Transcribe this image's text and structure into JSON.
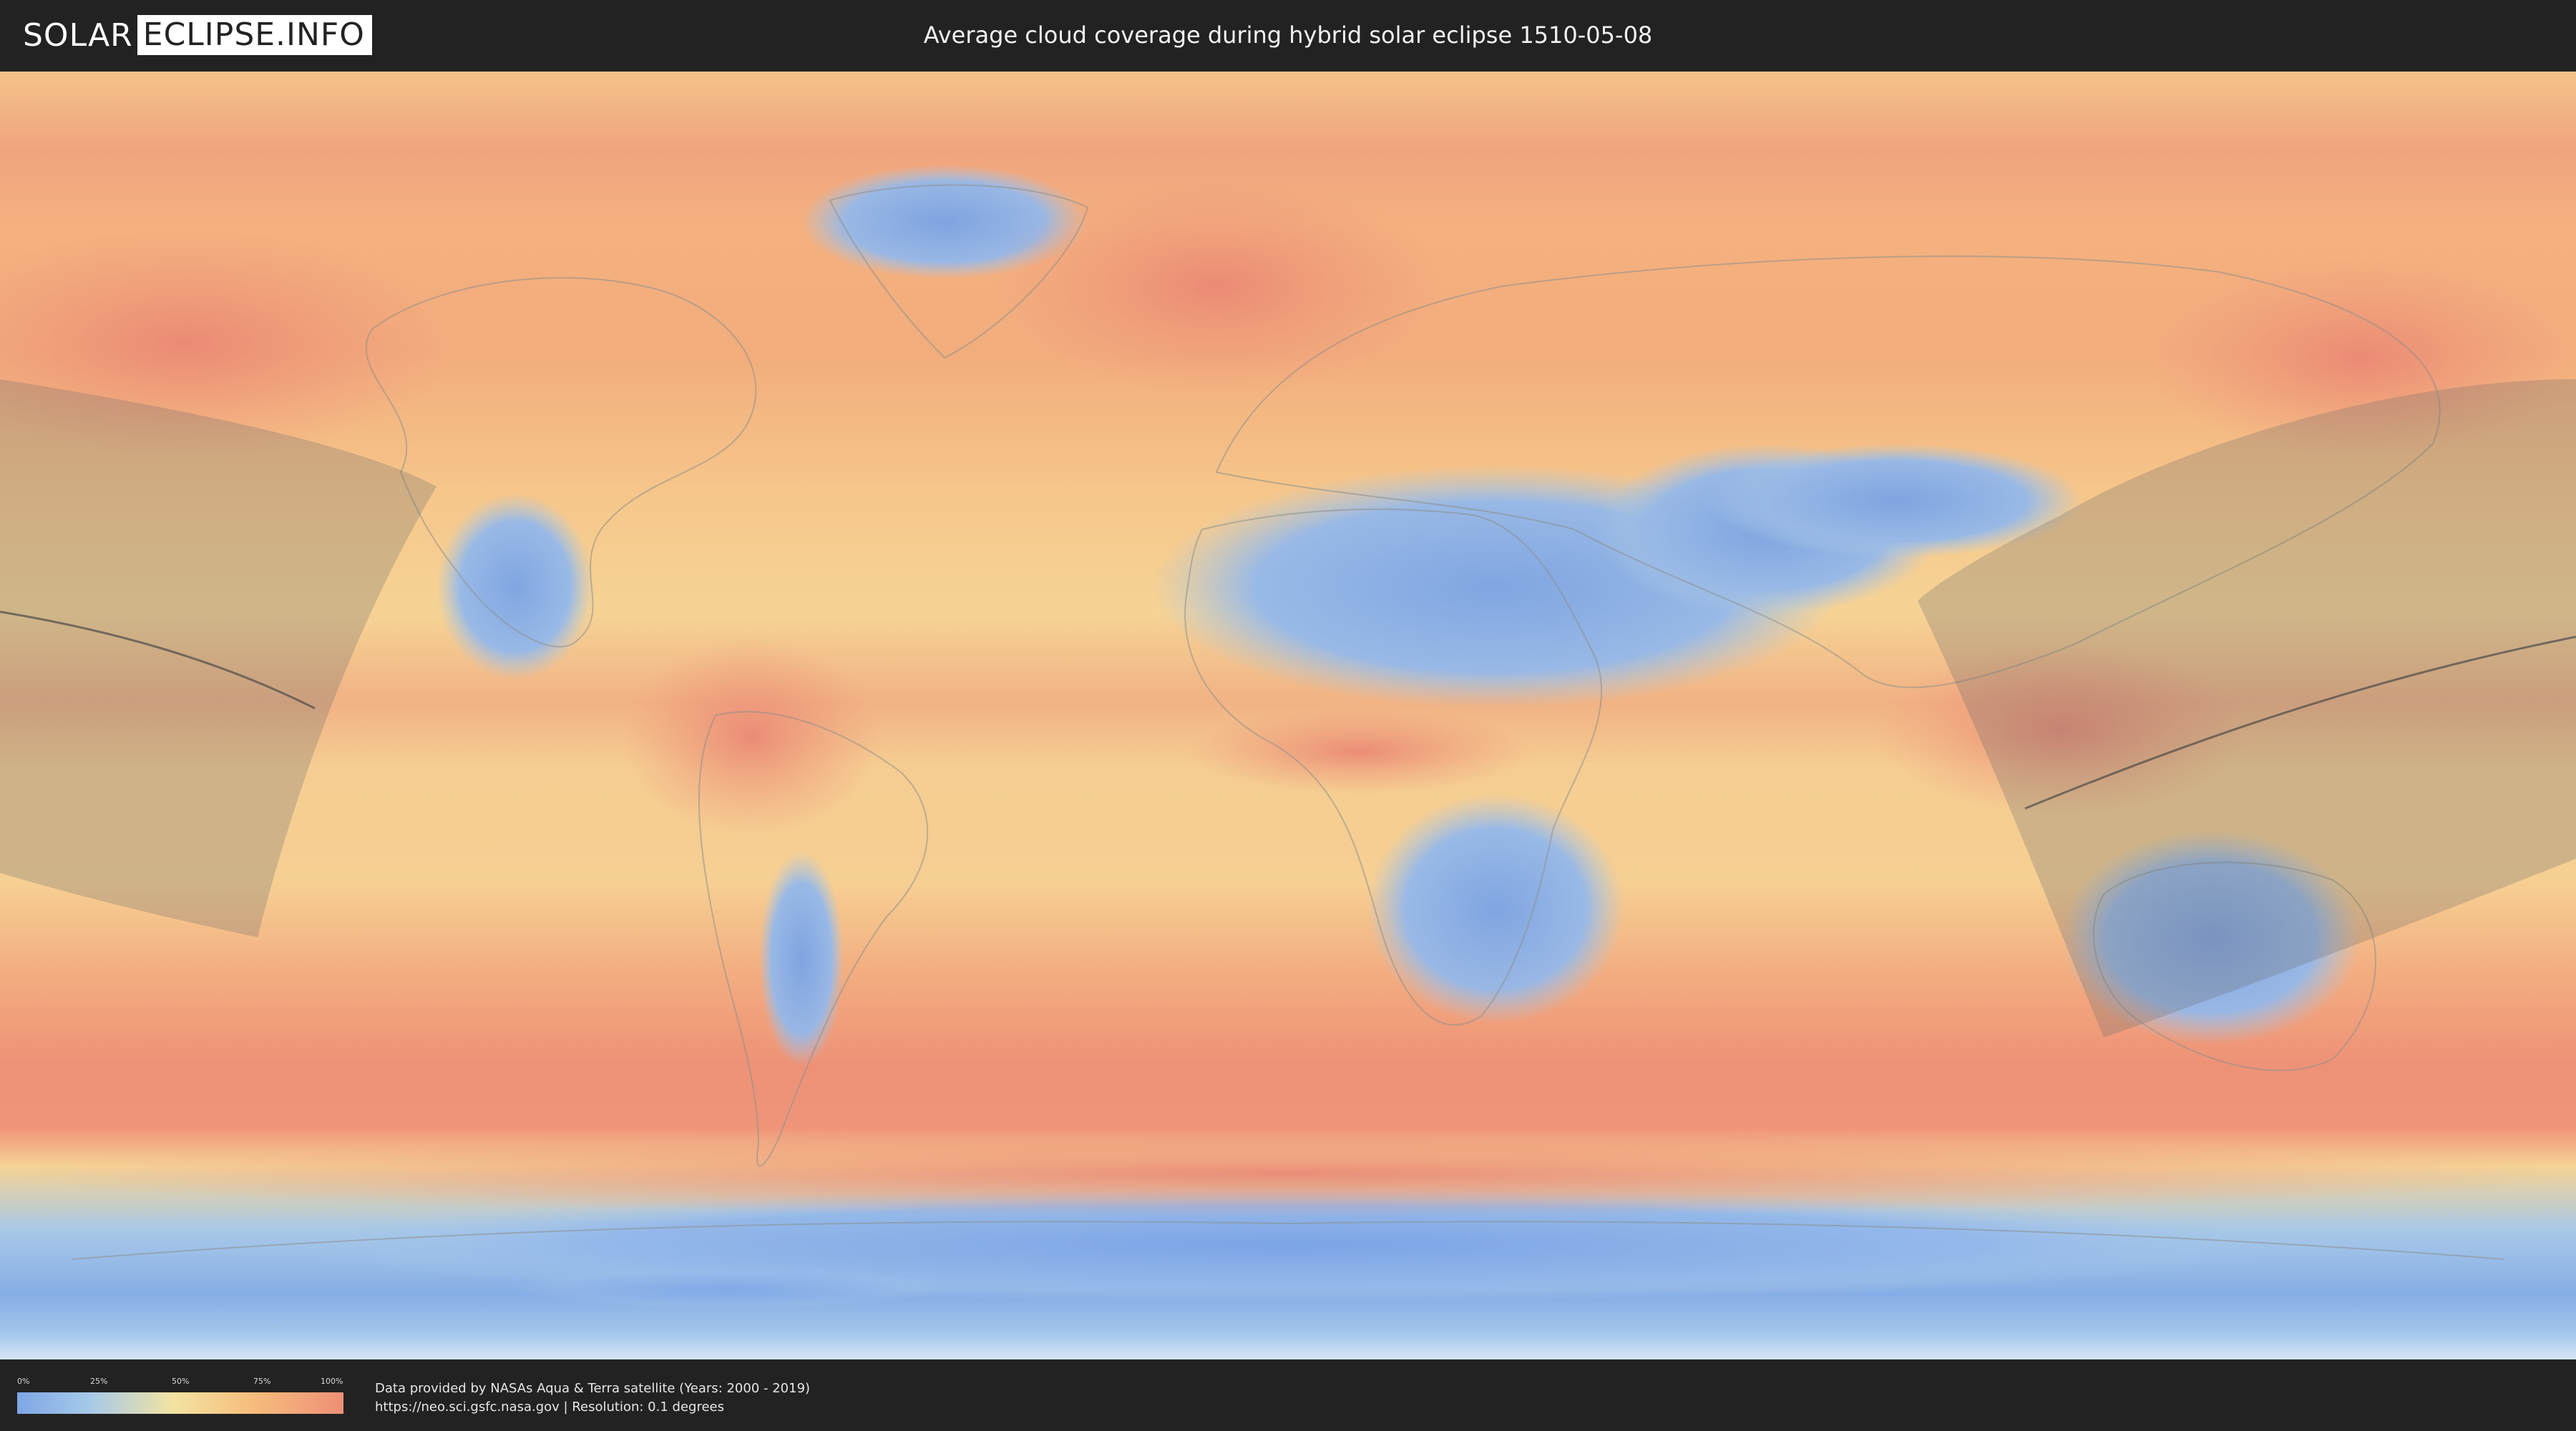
{
  "header": {
    "logo_part1": "SOLAR",
    "logo_part2": "ECLIPSE.INFO",
    "title": "Average cloud coverage during hybrid solar eclipse 1510-05-08"
  },
  "map": {
    "projection": "equirectangular",
    "palette": {
      "clear": "#7ea6e6",
      "low": "#a6c9e9",
      "mid": "#f3e3a2",
      "high": "#f6bd7c",
      "overcast": "#ee8f77"
    },
    "shading_color": "#6a6a6a"
  },
  "legend": {
    "labels": [
      "0%",
      "25%",
      "50%",
      "75%",
      "100%"
    ]
  },
  "footer": {
    "credit_line1": "Data provided by NASAs Aqua & Terra satellite (Years: 2000 - 2019)",
    "credit_line2": "https://neo.sci.gsfc.nasa.gov | Resolution: 0.1 degrees"
  }
}
